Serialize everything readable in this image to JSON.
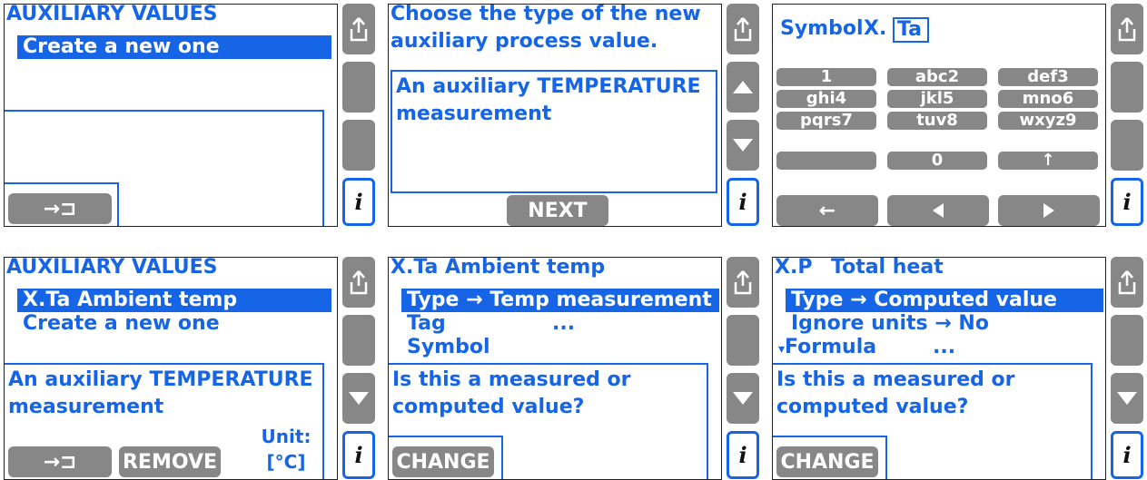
{
  "icons": {
    "upload": "upload-icon",
    "up": "arrow-up-icon",
    "down": "arrow-down-icon",
    "info": "info-icon",
    "enter": "enter-icon",
    "left": "arrow-left-icon",
    "nav_left": "triangle-left-icon",
    "nav_right": "triangle-right-icon",
    "shift": "shift-up-icon"
  },
  "colors": {
    "accent": "#1565e6",
    "button": "#878787",
    "border": "#222222"
  },
  "p1": {
    "header": "AUXILIARY VALUES",
    "items": [
      "Create a new one"
    ],
    "enter_label": "→⊐"
  },
  "p2": {
    "header_lines": [
      "Choose the type of the new",
      "auxiliary process value."
    ],
    "box_lines": [
      "An auxiliary TEMPERATURE",
      "measurement"
    ],
    "next": "NEXT"
  },
  "p3": {
    "label": "Symbol",
    "prefix": "X.",
    "input_value": "Ta",
    "keys": [
      "1",
      "abc2",
      "def3",
      "ghi4",
      "jkl5",
      "mno6",
      "pqrs7",
      "tuv8",
      "wxyz9",
      "",
      "0",
      "↑"
    ],
    "backspace": "←"
  },
  "p4": {
    "header": "AUXILIARY VALUES",
    "items": [
      "X.Ta Ambient temp",
      "Create a new one"
    ],
    "box_lines": [
      "An auxiliary TEMPERATURE",
      "measurement"
    ],
    "unit_label": "Unit:",
    "unit_value": "[°C]",
    "enter_label": "→⊐",
    "remove": "REMOVE"
  },
  "p5": {
    "header": "X.Ta Ambient temp",
    "items": [
      {
        "label": "Type",
        "arrow": "→",
        "value": "Temp measurement"
      },
      {
        "label": "Tag",
        "value": "..."
      },
      {
        "label": "Symbol"
      }
    ],
    "box_lines": [
      "Is this a measured or",
      "computed value?"
    ],
    "change": "CHANGE"
  },
  "p6": {
    "header_sym": "X.P",
    "header_name": "Total heat",
    "items": [
      {
        "label": "Type",
        "arrow": "→",
        "value": "Computed value"
      },
      {
        "label": "Ignore units",
        "arrow": "→",
        "value": "No"
      },
      {
        "prefix": "▾",
        "label": "Formula",
        "value": "..."
      }
    ],
    "box_lines": [
      "Is this a measured or",
      "computed value?"
    ],
    "change": "CHANGE"
  }
}
